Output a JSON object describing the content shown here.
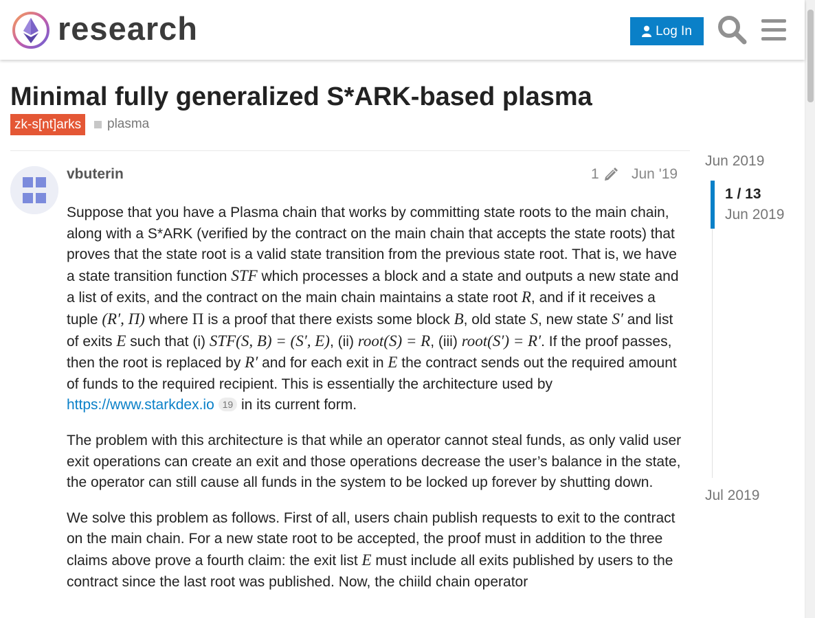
{
  "header": {
    "site_name": "research",
    "login_label": "Log In"
  },
  "topic": {
    "title": "Minimal fully generalized S*ARK-based plasma",
    "category": "zk-s[nt]arks",
    "tag": "plasma"
  },
  "post": {
    "author": "vbuterin",
    "edit_count": "1",
    "date": "Jun '19",
    "paragraphs": {
      "p1": {
        "t1": "Suppose that you have a Plasma chain that works by committing state roots to the main chain, along with a S*ARK (verified by the contract on the main chain that accepts the state roots) that proves that the state root is a valid state transition from the previous state root. That is, we have a state transition function ",
        "m1": "STF",
        "t2": " which processes a block and a state and outputs a new state and a list of exits, and the contract on the main chain maintains a state root ",
        "m2": "R",
        "t3": ", and if it receives a tuple ",
        "m3": "(R′, Π)",
        "t4": " where ",
        "m4": "Π",
        "t5": " is a proof that there exists some block ",
        "m5": "B",
        "t6": ", old state ",
        "m6": "S",
        "t7": ", new state ",
        "m7": "S′",
        "t8": " and list of exits ",
        "m8": "E",
        "t9": " such that (i) ",
        "m9": "STF(S, B) = (S′, E)",
        "t10": ", (ii) ",
        "m10": "root(S) = R",
        "t11": ", (iii) ",
        "m11": "root(S′) = R′",
        "t12": ". If the proof passes, then the root is replaced by ",
        "m12": "R′",
        "t13": " and for each exit in ",
        "m13": "E",
        "t14": " the contract sends out the required amount of funds to the required recipient. This is essentially the architecture used by ",
        "link": "https://www.starkdex.io",
        "link_clicks": "19",
        "t15": " in its current form."
      },
      "p2": "The problem with this architecture is that while an operator cannot steal funds, as only valid user exit operations can create an exit and those operations decrease the user’s balance in the state, the operator can still cause all funds in the system to be locked up forever by shutting down.",
      "p3": {
        "t1": "We solve this problem as follows. First of all, users chain publish requests to exit to the contract on the main chain. For a new state root to be accepted, the proof must in addition to the three claims above prove a fourth claim: the exit list ",
        "m1": "E",
        "t2": " must include all exits published by users to the contract since the last root was published. Now, the chiild chain operator"
      }
    }
  },
  "timeline": {
    "start_date": "Jun 2019",
    "position": "1 / 13",
    "position_date": "Jun 2019",
    "end_date": "Jul 2019"
  },
  "colors": {
    "accent": "#0a80c8",
    "category": "#e45735"
  },
  "icons": {
    "logo": "ethereum-research-logo",
    "login": "user-icon",
    "search": "search-icon",
    "menu": "hamburger-menu-icon",
    "edit": "pencil-icon"
  }
}
